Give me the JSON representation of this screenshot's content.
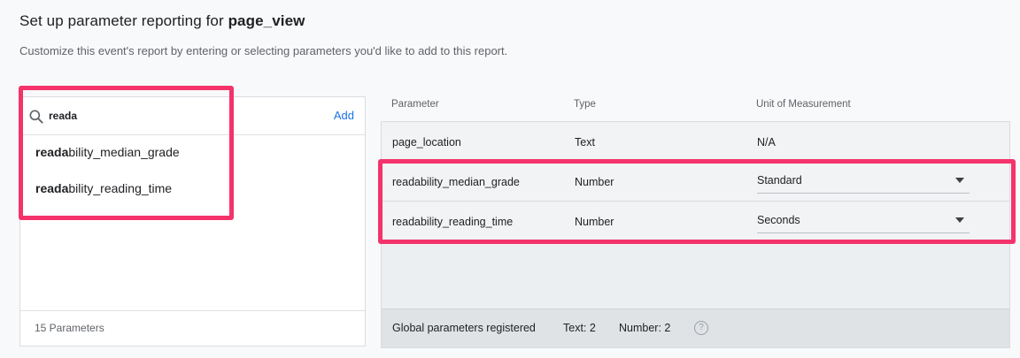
{
  "page": {
    "title_prefix": "Set up parameter reporting for ",
    "title_event": "page_view",
    "subtitle": "Customize this event's report by entering or selecting parameters you'd like to add to this report."
  },
  "search": {
    "value": "reada",
    "add_label": "Add"
  },
  "suggestions": [
    {
      "match": "reada",
      "rest": "bility_median_grade"
    },
    {
      "match": "reada",
      "rest": "bility_reading_time"
    }
  ],
  "left_footer": {
    "count_label": "15 Parameters"
  },
  "table": {
    "headers": {
      "parameter": "Parameter",
      "type": "Type",
      "unit": "Unit of Measurement"
    },
    "rows": [
      {
        "parameter": "page_location",
        "type": "Text",
        "unit": "N/A"
      },
      {
        "parameter": "readability_median_grade",
        "type": "Number",
        "unit": "Standard"
      },
      {
        "parameter": "readability_reading_time",
        "type": "Number",
        "unit": "Seconds"
      }
    ]
  },
  "right_footer": {
    "label": "Global parameters registered",
    "text_count": "Text: 2",
    "number_count": "Number: 2",
    "help": "?"
  },
  "colors": {
    "accent": "#1a73e8",
    "highlight": "#f4336b"
  },
  "icons": [
    "search-icon",
    "chevron-down-icon",
    "help-icon"
  ]
}
